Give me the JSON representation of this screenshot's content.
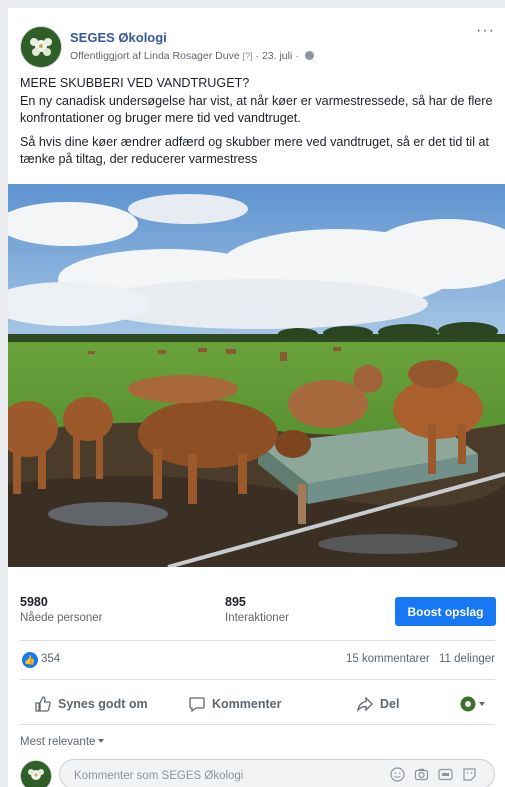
{
  "post": {
    "page_name": "SEGES Økologi",
    "published_by": "Offentliggjort af Linda Rosager Duve",
    "help_mark": "[?]",
    "date": "23. juli",
    "more_glyph": "···",
    "text": [
      "MERE SKUBBERI VED VANDTRUGET?",
      "En ny canadisk undersøgelse har vist, at når køer er varmestressede, så har de flere konfrontationer og bruger mere tid ved vandtruget.",
      "Så hvis dine køer ændrer adfærd og skubber mere ved vandtruget, så er det tid til at tænke på tiltag, der reducerer varmestress"
    ]
  },
  "insights": {
    "reach_value": "5980",
    "reach_label": "Nåede personer",
    "interactions_value": "895",
    "interactions_label": "Interaktioner",
    "boost_label": "Boost opslag"
  },
  "reactions": {
    "likes": "354",
    "comments": "15 kommentarer",
    "shares": "11 delinger"
  },
  "actions": {
    "like": "Synes godt om",
    "comment": "Kommenter",
    "share": "Del"
  },
  "comments": {
    "sort_label": "Mest relevante",
    "input_placeholder": "Kommenter som SEGES Økologi"
  },
  "icons": [
    "globe-icon",
    "like-icon",
    "comment-icon",
    "share-icon",
    "emoji-icon",
    "camera-icon",
    "gif-icon",
    "sticker-icon"
  ],
  "colors": {
    "link": "#385898",
    "accent": "#1877f2",
    "muted": "#606770"
  }
}
